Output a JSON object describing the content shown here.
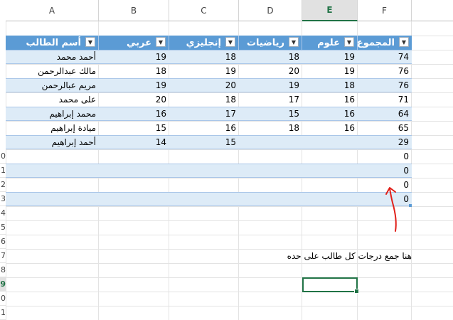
{
  "columns": [
    "A",
    "B",
    "C",
    "D",
    "E",
    "F"
  ],
  "active_column": "E",
  "row_numbers": [
    "0",
    "1",
    "2",
    "3",
    "4",
    "5",
    "6",
    "7",
    "8",
    "9",
    "0",
    "1"
  ],
  "table": {
    "headers": {
      "name": "أسم الطالب",
      "arabic": "عربي",
      "english": "إنجليزي",
      "math": "رياضيات",
      "science": "علوم",
      "total": "المجموع"
    },
    "rows": [
      {
        "name": "أحمد محمد",
        "arabic": "19",
        "english": "18",
        "math": "18",
        "science": "19",
        "total": "74"
      },
      {
        "name": "مالك عبدالرحمن",
        "arabic": "18",
        "english": "19",
        "math": "20",
        "science": "19",
        "total": "76"
      },
      {
        "name": "مريم عبالرحمن",
        "arabic": "19",
        "english": "20",
        "math": "19",
        "science": "18",
        "total": "76"
      },
      {
        "name": "على محمد",
        "arabic": "20",
        "english": "18",
        "math": "17",
        "science": "16",
        "total": "71"
      },
      {
        "name": "محمد إبراهيم",
        "arabic": "16",
        "english": "17",
        "math": "15",
        "science": "16",
        "total": "64"
      },
      {
        "name": "ميادة إبراهيم",
        "arabic": "15",
        "english": "16",
        "math": "18",
        "science": "16",
        "total": "65"
      },
      {
        "name": "أحمد إبراهيم",
        "arabic": "14",
        "english": "15",
        "math": "",
        "science": "",
        "total": "29"
      },
      {
        "name": "",
        "arabic": "",
        "english": "",
        "math": "",
        "science": "",
        "total": "0"
      },
      {
        "name": "",
        "arabic": "",
        "english": "",
        "math": "",
        "science": "",
        "total": "0"
      },
      {
        "name": "",
        "arabic": "",
        "english": "",
        "math": "",
        "science": "",
        "total": "0"
      },
      {
        "name": "",
        "arabic": "",
        "english": "",
        "math": "",
        "science": "",
        "total": "0"
      }
    ]
  },
  "note": "هنا جمع درجات كل طالب على حده",
  "filter_icon": "filter-dropdown-icon",
  "annotation_color": "#e0201a",
  "header_color": "#5b9bd5",
  "band_color": "#ddebf7",
  "selection_color": "#217346"
}
